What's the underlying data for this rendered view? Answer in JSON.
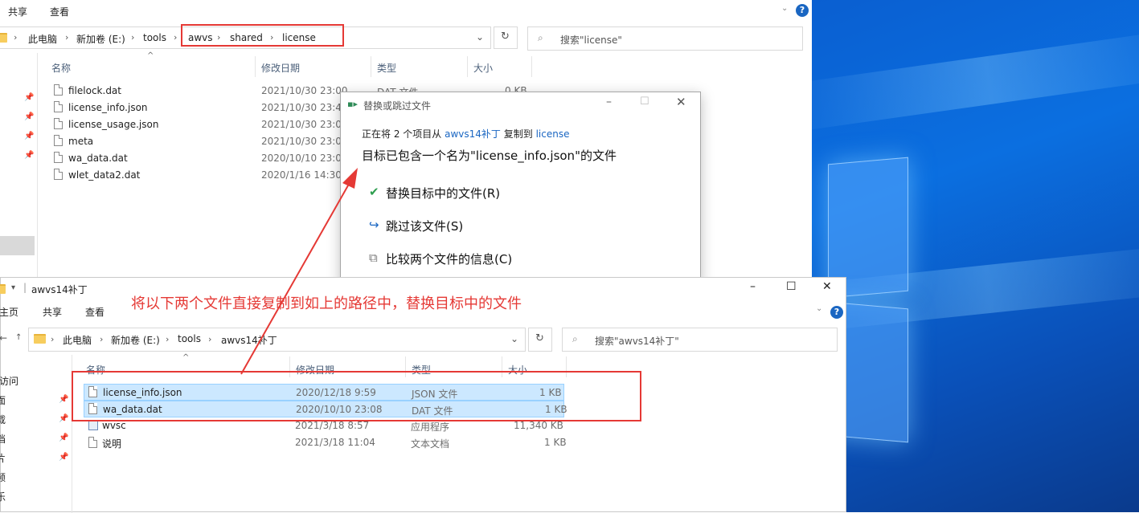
{
  "window1": {
    "ribbon": [
      "共享",
      "查看"
    ],
    "breadcrumb": [
      "此电脑",
      "新加卷 (E:)",
      "tools",
      "awvs",
      "shared",
      "license"
    ],
    "search_placeholder": "搜索\"license\"",
    "columns": [
      "名称",
      "修改日期",
      "类型",
      "大小"
    ],
    "files": [
      {
        "name": "filelock.dat",
        "date": "2021/10/30 23:00",
        "type": "DAT 文件",
        "size": "0 KB"
      },
      {
        "name": "license_info.json",
        "date": "2021/10/30 23:41"
      },
      {
        "name": "license_usage.json",
        "date": "2021/10/30 23:01"
      },
      {
        "name": "meta",
        "date": "2021/10/30 23:00"
      },
      {
        "name": "wa_data.dat",
        "date": "2020/10/10 23:08"
      },
      {
        "name": "wlet_data2.dat",
        "date": "2020/1/16 14:30"
      }
    ]
  },
  "dialog": {
    "title": "替换或跳过文件",
    "line_prefix": "正在将 2 个项目从",
    "line_source": "awvs14补丁",
    "line_mid": "复制到",
    "line_dest": "license",
    "heading": "目标已包含一个名为\"license_info.json\"的文件",
    "options": [
      "替换目标中的文件(R)",
      "跳过该文件(S)",
      "比较两个文件的信息(C)"
    ]
  },
  "window2": {
    "title": "awvs14补丁",
    "ribbon": [
      "主页",
      "共享",
      "查看"
    ],
    "breadcrumb": [
      "此电脑",
      "新加卷 (E:)",
      "tools",
      "awvs14补丁"
    ],
    "search_placeholder": "搜索\"awvs14补丁\"",
    "columns": [
      "名称",
      "修改日期",
      "类型",
      "大小"
    ],
    "files": [
      {
        "name": "license_info.json",
        "date": "2020/12/18 9:59",
        "type": "JSON 文件",
        "size": "1 KB",
        "selected": true
      },
      {
        "name": "wa_data.dat",
        "date": "2020/10/10 23:08",
        "type": "DAT 文件",
        "size": "1 KB",
        "selected": true
      },
      {
        "name": "wvsc",
        "date": "2021/3/18 8:57",
        "type": "应用程序",
        "size": "11,340 KB"
      },
      {
        "name": "说明",
        "date": "2021/3/18 11:04",
        "type": "文本文档",
        "size": "1 KB"
      }
    ],
    "leftnav": [
      "访问",
      "面",
      "载",
      "档",
      "片",
      "频",
      "乐"
    ]
  },
  "annotation": "将以下两个文件直接复制到如上的路径中，替换目标中的文件",
  "colors": {
    "annotation_red": "#e53935",
    "selection": "#cce8ff",
    "link_blue": "#1a66c2",
    "desktop_blue": "#0a5fd1"
  }
}
